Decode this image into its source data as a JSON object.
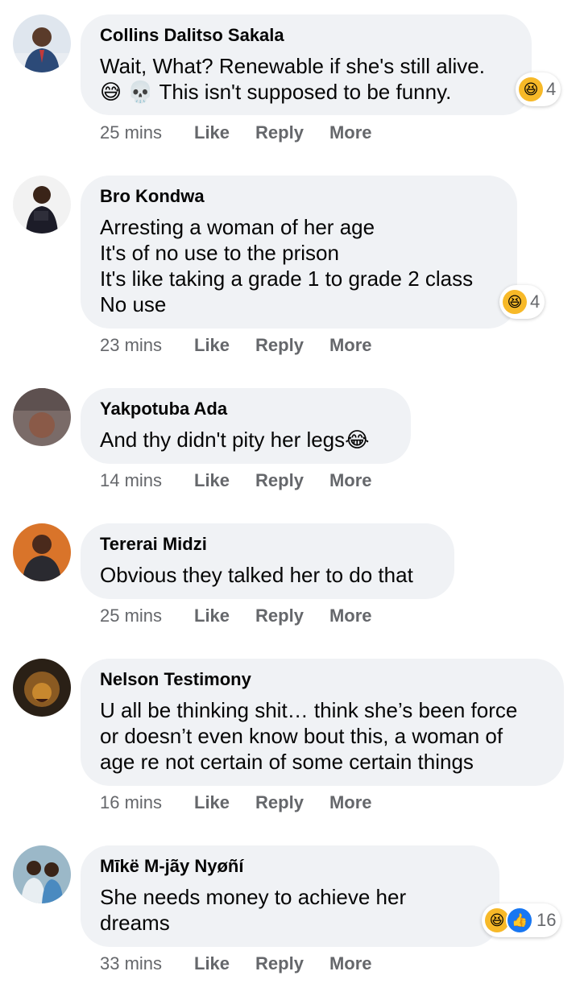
{
  "comments": [
    {
      "author": "Collins Dalitso Sakala",
      "text": "Wait, What? Renewable if she's still alive.",
      "text2": "😅 💀 This isn't supposed to be funny.",
      "time": "25 mins",
      "reaction_count": "4"
    },
    {
      "author": "Bro Kondwa",
      "text": "Arresting a woman of her age\nIt's of no use to the prison\nIt's like taking a grade 1 to grade 2 class\nNo use",
      "time": "23 mins",
      "reaction_count": "4"
    },
    {
      "author": "Yakpotuba Ada",
      "text": "And thy didn't pity her legs😂",
      "time": "14 mins"
    },
    {
      "author": "Tererai Midzi",
      "text": "Obvious they talked her to do that",
      "time": "25 mins"
    },
    {
      "author": "Nelson Testimony",
      "text": "U all be thinking shit… think she’s been force\nor doesn’t even know bout this, a woman of\nage re not certain of some certain things",
      "time": "16 mins"
    },
    {
      "author": "Mīkë M-jãy Nyøñí",
      "text": "She needs money to achieve her\ndreams",
      "time": "33 mins",
      "reaction_count": "16"
    }
  ],
  "actions": {
    "like": "Like",
    "reply": "Reply",
    "more": "More"
  },
  "reaction_icons": {
    "laugh": "😆",
    "like": "👍"
  },
  "colors": {
    "bubble": "#f0f2f5",
    "meta": "#65676b",
    "text": "#050505",
    "like_blue": "#1877f2",
    "emoji_yellow": "#f7b928"
  }
}
